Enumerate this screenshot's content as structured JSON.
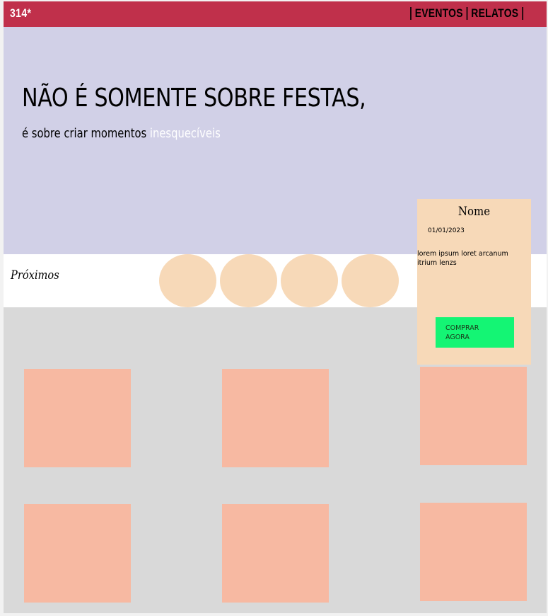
{
  "header": {
    "brand": "314*",
    "nav": [
      {
        "label": "EVENTOS"
      },
      {
        "label": "RELATOS"
      }
    ]
  },
  "hero": {
    "title": "NÃO É SOMENTE SOBRE FESTAS,",
    "subtitle_prefix": "é sobre criar momentos ",
    "subtitle_highlight": "inesquecíveis"
  },
  "upcoming": {
    "label": "Próximos",
    "circle_count": 4
  },
  "event_card": {
    "name": "Nome",
    "date": "01/01/2023",
    "description": "lorem ipsum loret arcanum itrium lenzs",
    "buy_label": "COMPRAR AGORA"
  },
  "colors": {
    "topbar": "#c0304b",
    "hero_bg": "#d1d0e7",
    "highlight_text": "#ffffff",
    "circle": "#f7d9b8",
    "card_bg": "#f7d9b8",
    "buy_button": "#14f574",
    "tile": "#f7b9a2",
    "grid_bg": "#d9d9d9"
  }
}
